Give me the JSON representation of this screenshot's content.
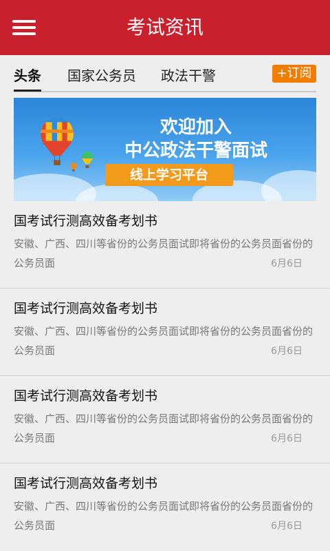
{
  "header": {
    "title": "考试资讯",
    "menu_icon": "hamburger-icon",
    "color": "#c8202c"
  },
  "tabs": [
    {
      "label": "头条",
      "active": true
    },
    {
      "label": "国家公务员",
      "active": false
    },
    {
      "label": "政法干警",
      "active": false
    }
  ],
  "subscribe": {
    "label": "+订阅",
    "color": "#f07c00"
  },
  "banner": {
    "line1": "欢迎加入",
    "line2": "中公政法干警面试",
    "button": "线上学习平台"
  },
  "news": [
    {
      "title": "国考试行测高效备考划书",
      "summary": "安徽、广西、四川等省份的公务员面试即将省份的公务员面省份的公务员面",
      "date": "6月6日"
    },
    {
      "title": "国考试行测高效备考划书",
      "summary": "安徽、广西、四川等省份的公务员面试即将省份的公务员面省份的公务员面",
      "date": "6月6日"
    },
    {
      "title": "国考试行测高效备考划书",
      "summary": "安徽、广西、四川等省份的公务员面试即将省份的公务员面省份的公务员面",
      "date": "6月6日"
    },
    {
      "title": "国考试行测高效备考划书",
      "summary": "安徽、广西、四川等省份的公务员面试即将省份的公务员面省份的公务员面",
      "date": "6月6日"
    }
  ]
}
